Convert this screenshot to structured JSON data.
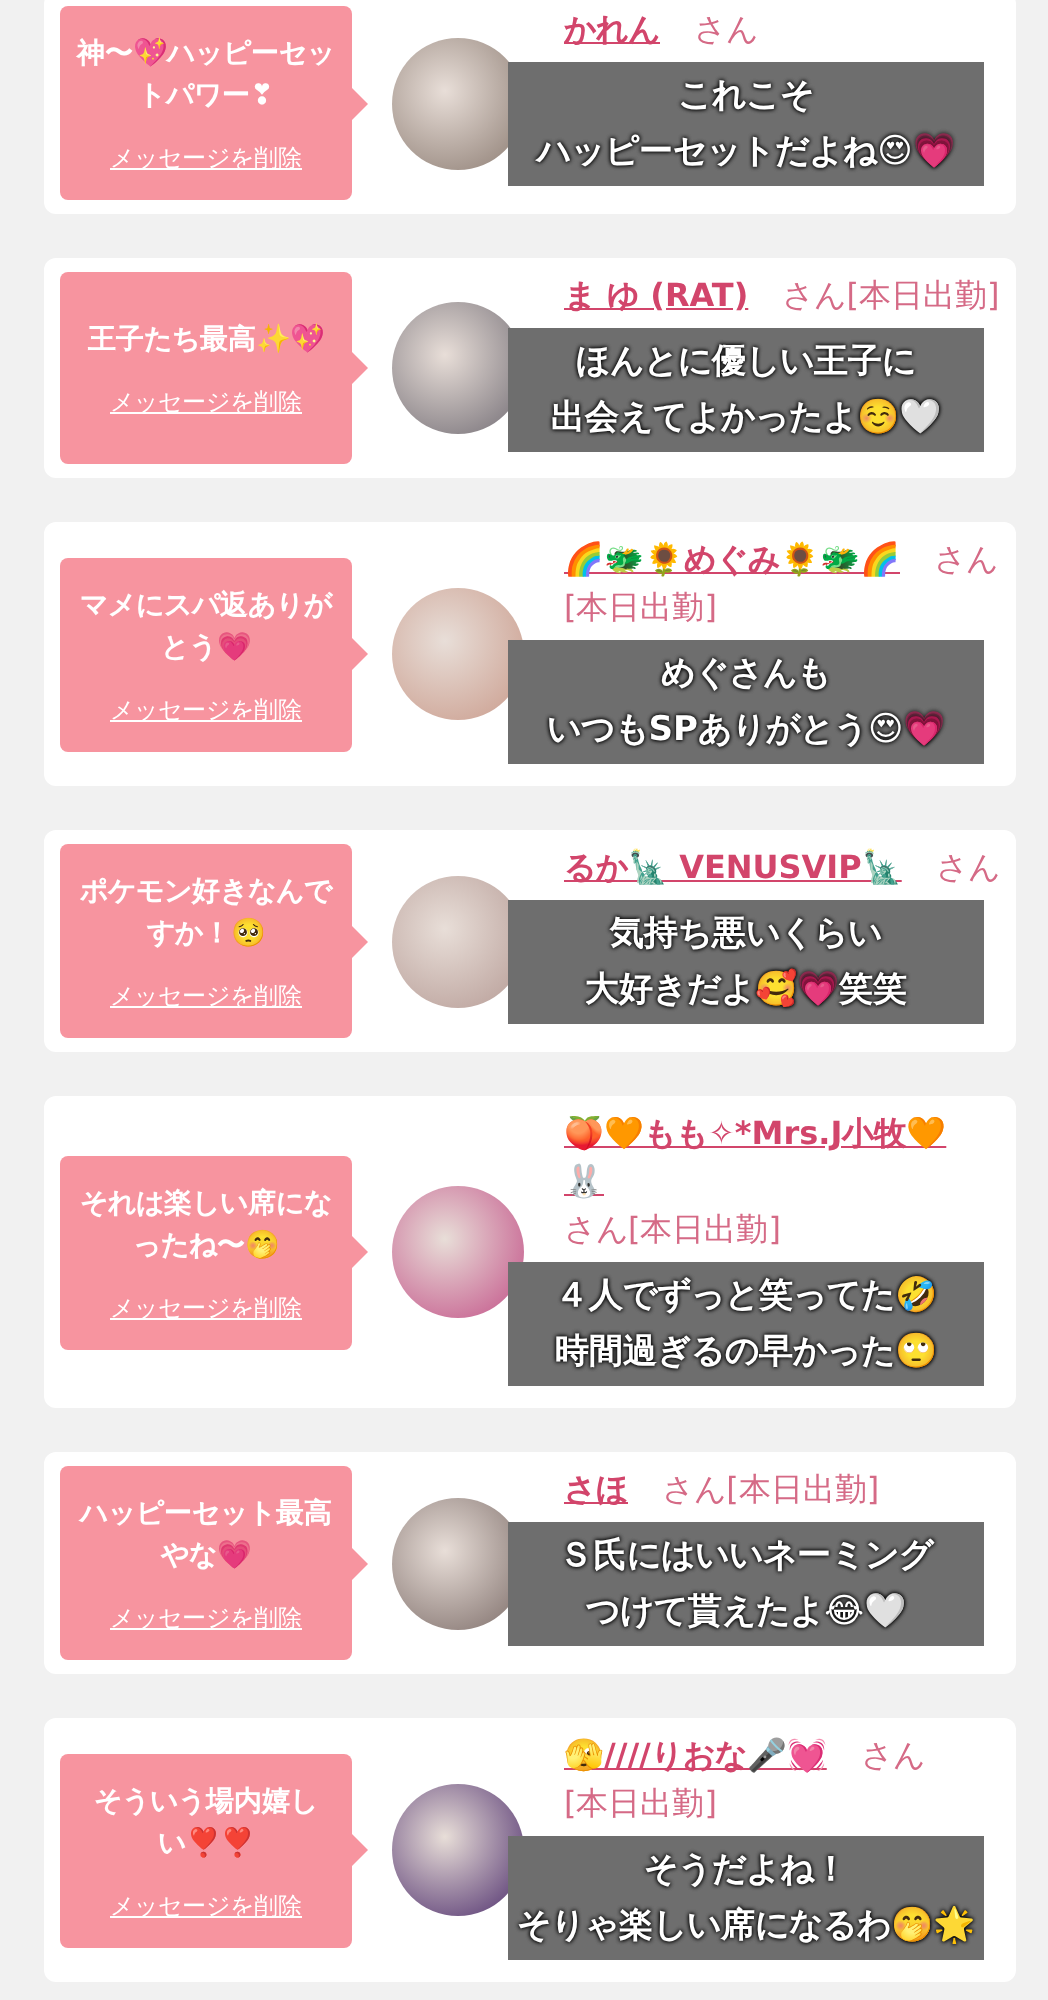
{
  "cards": [
    {
      "message": "神〜💖ハッピーセットパワー❣",
      "delete_link": "メッセージを削除",
      "name": "かれん",
      "honorific": "さん",
      "caption": [
        "これこそ",
        "ハッピーセットだよね😍💗"
      ]
    },
    {
      "message": "王子たち最高✨💖",
      "delete_link": "メッセージを削除",
      "name": "ま ゆ (RAT)",
      "honorific": "さん",
      "status": "[本日出勤]",
      "caption": [
        "ほんとに優しい王子に",
        "出会えてよかったよ☺️🤍"
      ]
    },
    {
      "message": "マメにスパ返ありがとう💗",
      "delete_link": "メッセージを削除",
      "name": "🌈🐲🌻めぐみ🌻🐲🌈",
      "honorific": "さん",
      "status": "[本日出勤]",
      "caption": [
        "めぐさんも",
        "いつもSPありがとう😍💗"
      ]
    },
    {
      "message": "ポケモン好きなんですか！🥺",
      "delete_link": "メッセージを削除",
      "name": "るか🗽 VENUSVIP🗽",
      "honorific": "さん",
      "caption": [
        "気持ち悪いくらい",
        "大好きだよ🥰💗笑笑"
      ]
    },
    {
      "message": "それは楽しい席になったね〜🤭",
      "delete_link": "メッセージを削除",
      "name": "🍑🧡もも✧*Mrs.J小牧🧡🐰",
      "honorific": "さん",
      "status": "[本日出勤]",
      "caption": [
        "４人でずっと笑ってた🤣",
        "時間過ぎるの早かった🙄"
      ]
    },
    {
      "message": "ハッピーセット最高やな💗",
      "delete_link": "メッセージを削除",
      "name": "さほ",
      "honorific": "さん",
      "status": "[本日出勤]",
      "caption": [
        "Ｓ氏にはいいネーミング",
        "つけて貰えたよ😂🤍"
      ]
    },
    {
      "message": "そういう場内嬉しい❣️❣️",
      "delete_link": "メッセージを削除",
      "name": "🫣////りおな🎤💓",
      "honorific": "さん",
      "status": "[本日出勤]",
      "caption": [
        "そうだよね！",
        "そりゃ楽しい席になるわ🤭🌟"
      ]
    }
  ]
}
